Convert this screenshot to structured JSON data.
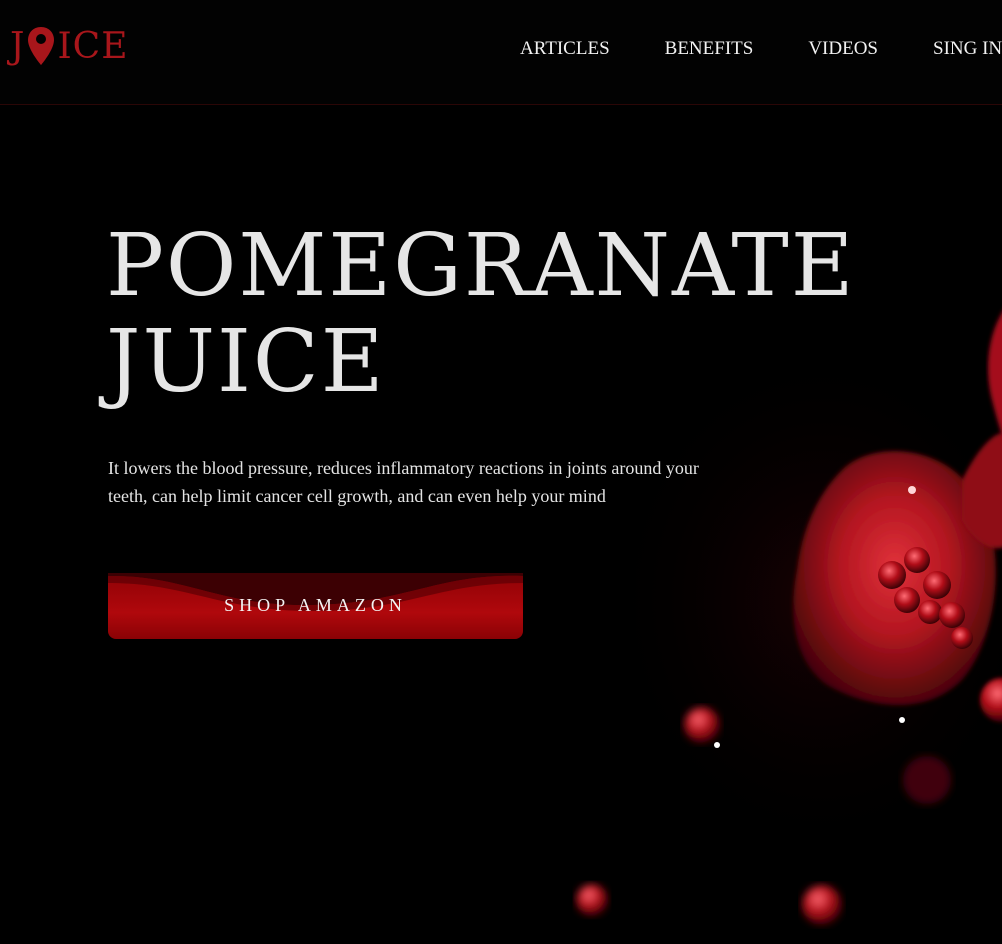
{
  "header": {
    "logo_left": "J",
    "logo_right": "ICE",
    "logo_icon": "map-pin-icon",
    "nav": [
      {
        "label": "ARTICLES"
      },
      {
        "label": "BENEFITS"
      },
      {
        "label": "VIDEOS"
      },
      {
        "label": "SING IN"
      }
    ]
  },
  "hero": {
    "title_line1": "POMEGRANATE",
    "title_line2": "JUICE",
    "description": "It lowers the blood pressure, reduces inflammatory reactions in joints around your teeth, can help limit cancer cell growth, and can even help your mind",
    "cta_label": "SHOP AMAZON",
    "image_icon": "pomegranate-image"
  },
  "colors": {
    "background": "#000000",
    "accent": "#a8161b",
    "button": "#b0080c",
    "text": "#ececec"
  }
}
